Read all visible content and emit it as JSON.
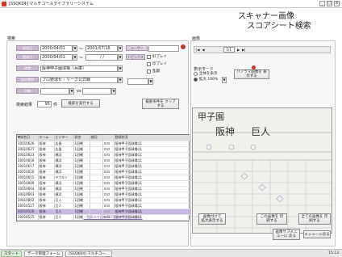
{
  "window": {
    "title": "[SSQK04] マルチコースライブラリーシステム",
    "controls": [
      "_",
      "□",
      "×"
    ]
  },
  "header": {
    "line1": "スキャナー画像",
    "line2": "スコアシート検索"
  },
  "search": {
    "section_title": "検索",
    "date_label": "試合日",
    "date_from": "2000/04/01",
    "date_sep": "～",
    "date_to": "2001/07/15",
    "user_label": "ユーザー",
    "entry_label": "登録日",
    "entry_from": "2000/04/01",
    "entry_sep": "～",
    "entry_to": "/ /",
    "topics_label": "トピックス",
    "stadium_label": "球場",
    "stadium_value": "阪神甲子園球場（兵庫）",
    "league_label": "試合種別",
    "league_value": "プロ野球セ・リーグ公式戦",
    "team_label": "対戦",
    "team_value": "",
    "team_vs": "vs",
    "checks": [
      "好プレイ",
      "珍プレイ",
      "乱闘"
    ],
    "result_label": "検索結果",
    "result_count": "95",
    "result_unit": "件",
    "run_button": "検索を実行する",
    "clear_button": "検索条件を クリアする"
  },
  "table": {
    "headers": [
      "▼試合日",
      "ホーム",
      "ビジター",
      "試合",
      "前回",
      "",
      "登録状況"
    ],
    "rows": [
      [
        "20010626",
        "阪神",
        "広島",
        "1回戦",
        "",
        "阪神甲子園球場(兵"
      ],
      [
        "20010627",
        "阪神",
        "広島",
        "1回戦",
        "",
        "阪神甲子園球場(兵"
      ],
      [
        "20010623",
        "阪神",
        "横浜",
        "1回戦",
        "",
        "阪神甲子園球場(兵"
      ],
      [
        "20010618",
        "阪神",
        "横浜",
        "1回戦",
        "",
        "阪神甲子園球場(兵"
      ],
      [
        "20010617",
        "阪神",
        "横浜",
        "1回戦",
        "",
        "阪神甲子園球場(兵"
      ],
      [
        "20010616",
        "阪神",
        "横浜",
        "1回戦",
        "",
        "阪神甲子園球場(兵"
      ],
      [
        "20010615",
        "阪神",
        "ヤクルト",
        "1回戦",
        "",
        "阪神甲子園球場(兵"
      ],
      [
        "20010609",
        "阪神",
        "横浜",
        "1回戦",
        "",
        "阪神甲子園球場(兵"
      ],
      [
        "20010604",
        "阪神",
        "横浜",
        "1回戦",
        "",
        "阪神甲子園球場(兵"
      ],
      [
        "20010603",
        "阪神",
        "横浜",
        "1回戦",
        "",
        "阪神甲子園球場(兵"
      ],
      [
        "20010602",
        "阪神",
        "巨人",
        "1回戦",
        "",
        "阪神甲子園球場(兵"
      ],
      [
        "20010527",
        "阪神",
        "巨人",
        "1回戦",
        "",
        "阪神甲子園球場(兵"
      ],
      [
        "20010526",
        "阪神",
        "巨人",
        "1回戦",
        "",
        "阪神甲子園球場(兵"
      ],
      [
        "20010525",
        "阪神",
        "巨人",
        "1回戦",
        "",
        "阪神甲子園球場(兵"
      ]
    ],
    "selected_row": 12,
    "footer_link": "一覧表の内容をCSV形式で 保存しておく"
  },
  "image": {
    "section_title": "画像",
    "page_indicator": "1/1",
    "display_mode_label": "表示モード",
    "mode_options": [
      "全体を表示",
      "拡大 100%"
    ],
    "panorama_button": "パノラマ画像を 表示する",
    "sheet": {
      "stadium": "甲子園",
      "home": "阪神",
      "visitor": "巨人"
    },
    "enlarge_button": "画像付けで 拡大表示する",
    "print_button": "この画像を 印刷する",
    "print_all_button": "全ての画像を 印刷する",
    "back_button": "画像サブメニューに 戻る",
    "menu_button": "メニューに戻る"
  },
  "taskbar": {
    "start": "スタート",
    "task1": "データ管理フォーム",
    "task2": "[SSQK04] マルチコー...",
    "clock": "15:13"
  },
  "colors": {
    "label_bg": "#c9b7cf",
    "selected_row": "#c8b7e2",
    "accent": "#d23b2a"
  }
}
